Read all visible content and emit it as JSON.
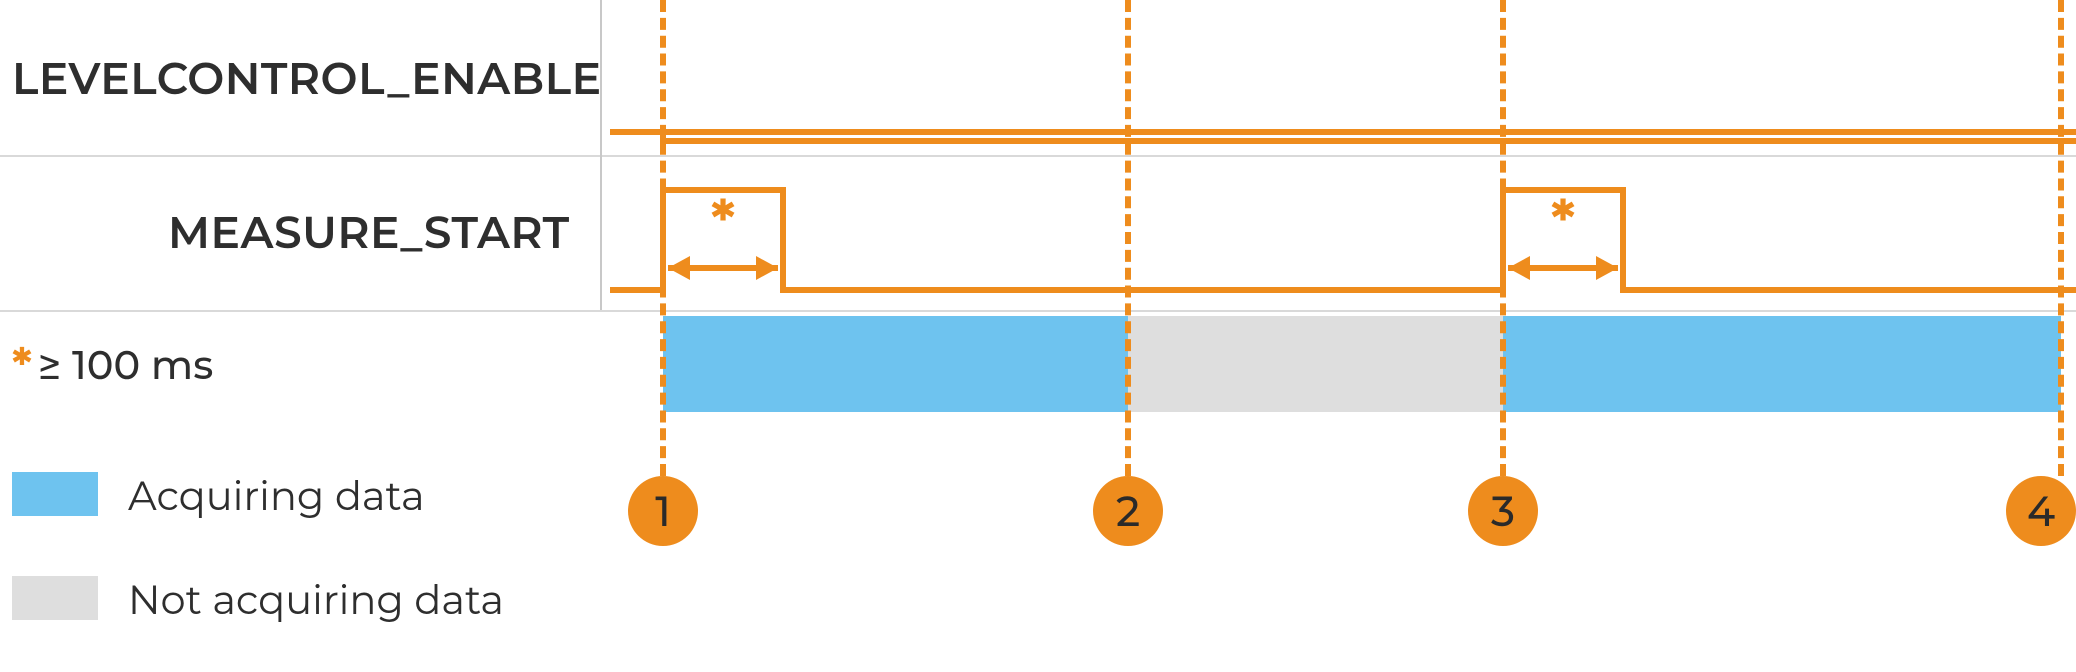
{
  "signals": {
    "row1_label": "LEVELCONTROL_ENABLE",
    "row2_label": "MEASURE_START"
  },
  "footnote": {
    "symbol": "*",
    "text": "≥ 100 ms"
  },
  "legend": {
    "acquiring": "Acquiring data",
    "not_acquiring": "Not acquiring data"
  },
  "events": {
    "e1": "1",
    "e2": "2",
    "e3": "3",
    "e4": "4"
  },
  "colors": {
    "orange": "#ee8c1d",
    "blue": "#6ec3ef",
    "grey": "#dedede"
  },
  "chart_data": {
    "type": "table",
    "description": "Timing diagram of two control signals and resulting data-acquisition state.",
    "time_axis": "events 1..4 (arbitrary time units 0..1000)",
    "signals": [
      {
        "name": "LEVELCONTROL_ENABLE",
        "edges": [
          [
            0,
            "low"
          ],
          [
            1,
            "high"
          ],
          [
            1000,
            "high"
          ]
        ]
      },
      {
        "name": "MEASURE_START",
        "edges": [
          [
            0,
            "low"
          ],
          [
            1,
            "high"
          ],
          [
            80,
            "low"
          ],
          [
            560,
            "high"
          ],
          [
            640,
            "low"
          ],
          [
            1000,
            "low"
          ]
        ],
        "pulse_min_duration": "≥ 100 ms"
      }
    ],
    "event_markers": [
      {
        "id": 1,
        "t": 0
      },
      {
        "id": 2,
        "t": 310
      },
      {
        "id": 3,
        "t": 560
      },
      {
        "id": 4,
        "t": 1000
      }
    ],
    "acquisition": [
      {
        "from_event": 1,
        "to_event": 2,
        "state": "acquiring"
      },
      {
        "from_event": 2,
        "to_event": 3,
        "state": "not_acquiring"
      },
      {
        "from_event": 3,
        "to_event": 4,
        "state": "acquiring"
      }
    ]
  }
}
